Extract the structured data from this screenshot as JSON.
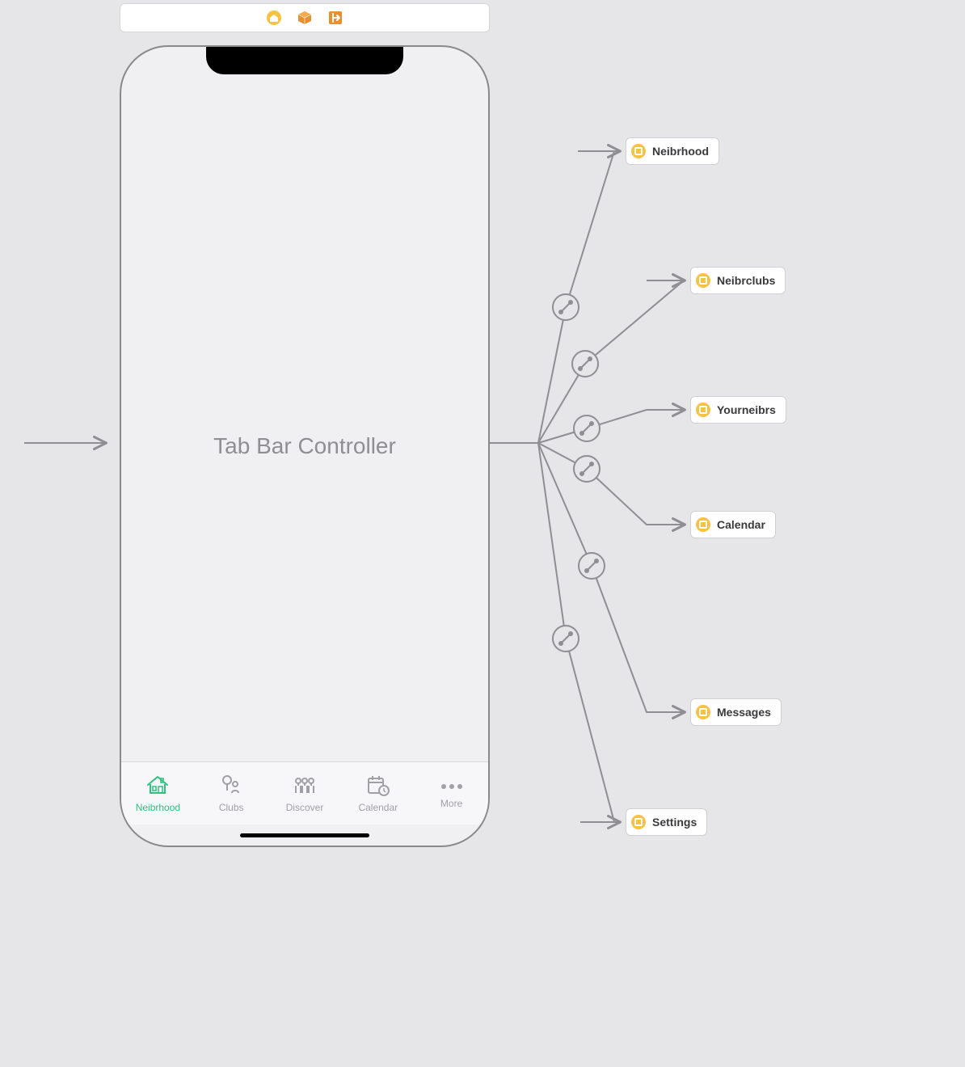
{
  "phone": {
    "title": "Tab Bar Controller"
  },
  "tabs": [
    {
      "label": "Neibrhood",
      "icon": "house-icon",
      "active": true
    },
    {
      "label": "Clubs",
      "icon": "tree-people-icon",
      "active": false
    },
    {
      "label": "Discover",
      "icon": "people-icon",
      "active": false
    },
    {
      "label": "Calendar",
      "icon": "calendar-clock-icon",
      "active": false
    },
    {
      "label": "More",
      "icon": "more-icon",
      "active": false
    }
  ],
  "destinations": [
    {
      "label": "Neibrhood"
    },
    {
      "label": "Neibrclubs"
    },
    {
      "label": "Yourneibrs"
    },
    {
      "label": "Calendar"
    },
    {
      "label": "Messages"
    },
    {
      "label": "Settings"
    }
  ],
  "toolbar_icons": [
    "house-circle-icon",
    "cube-icon",
    "exit-icon"
  ]
}
